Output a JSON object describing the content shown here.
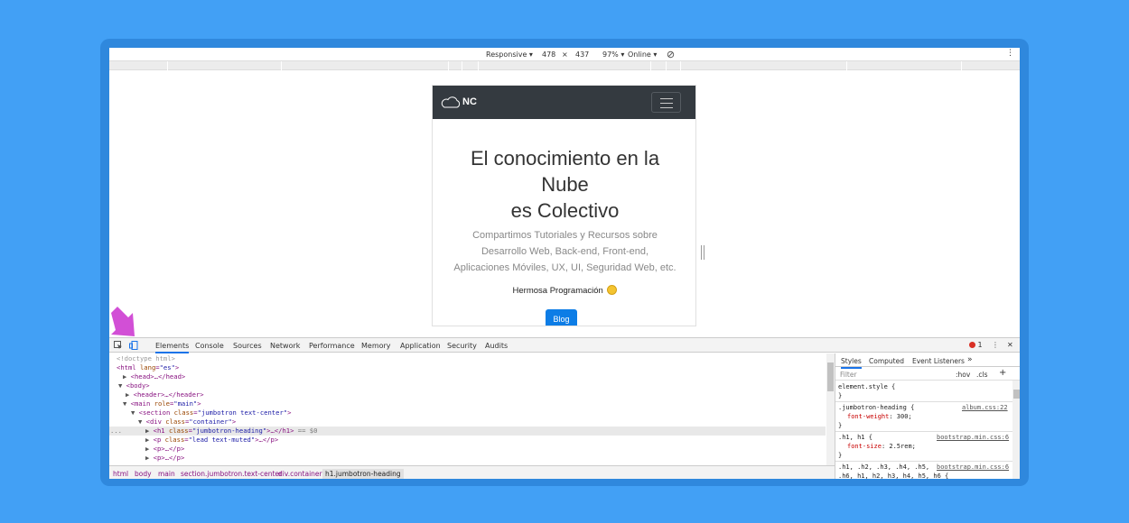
{
  "device_toolbar": {
    "device": "Responsive ▾",
    "width": "478",
    "x": "×",
    "height": "437",
    "zoom": "97% ▾",
    "network": "Online ▾",
    "rotate_icon": "rotate-icon",
    "menu": "⋮"
  },
  "page": {
    "brand": "NC",
    "heading_line1": "El conocimiento en la",
    "heading_line2": "Nube",
    "heading_line3": "es Colectivo",
    "lead_line1": "Compartimos Tutoriales y Recursos sobre",
    "lead_line2": "Desarrollo Web, Back-end, Front-end,",
    "lead_line3": "Aplicaciones Móviles, UX, UI, Seguridad Web, etc.",
    "tagline": "Hermosa Programación",
    "blog_button": "Blog"
  },
  "devtools": {
    "tabs": [
      "Elements",
      "Console",
      "Sources",
      "Network",
      "Performance",
      "Memory",
      "Application",
      "Security",
      "Audits"
    ],
    "error_count": "1",
    "menu": "⋮",
    "close": "✕",
    "dom_lines": [
      {
        "indent": "",
        "text": "<!doctype html>",
        "comment": true
      },
      {
        "indent": "",
        "text": "<html lang=\"es\">"
      },
      {
        "indent": "▶",
        "text": "<head>…</head>"
      },
      {
        "indent": "▼",
        "text": "<body>"
      },
      {
        "indent": "▶",
        "text": "<header>…</header>"
      },
      {
        "indent": "▼",
        "text": "<main role=\"main\">"
      },
      {
        "indent": "▼",
        "text": "<section class=\"jumbotron text-center\">"
      },
      {
        "indent": "▼",
        "text": "<div class=\"container\">"
      },
      {
        "indent": "▶",
        "text": "<h1 class=\"jumbotron-heading\">…</h1> == $0"
      },
      {
        "indent": "▶",
        "text": "<p class=\"lead text-muted\">…</p>"
      },
      {
        "indent": "▶",
        "text": "<p>…</p>"
      },
      {
        "indent": "▶",
        "text": "<p>…</p>"
      }
    ],
    "selected_prefix": "...",
    "breadcrumbs": [
      "html",
      "body",
      "main",
      "section.jumbotron.text-center",
      "div.container",
      "h1.jumbotron-heading"
    ],
    "styles_tabs": [
      "Styles",
      "Computed",
      "Event Listeners",
      "»"
    ],
    "filter_placeholder": "Filter",
    "hov": ":hov",
    "cls": ".cls",
    "plus": "+",
    "rules": {
      "r1a": "element.style {",
      "r1b": "}",
      "r2a": ".jumbotron-heading {",
      "r2src": "album.css:22",
      "r2prop": "font-weight",
      "r2val": ": 300;",
      "r2c": "}",
      "r3a": ".h1, h1 {",
      "r3src": "bootstrap.min.css:6",
      "r3prop": "font-size",
      "r3val": ": 2.5rem;",
      "r3c": "}",
      "r4a": ".h1, .h2, .h3, .h4, .h5,",
      "r4src": "bootstrap.min.css:6",
      "r4b": ".h6, h1, h2, h3, h4, h5, h6 {"
    }
  },
  "colors": {
    "background": "#42a0f5",
    "navbar": "#343a40",
    "button": "#0d7de6",
    "arrow": "#d24fd6"
  }
}
